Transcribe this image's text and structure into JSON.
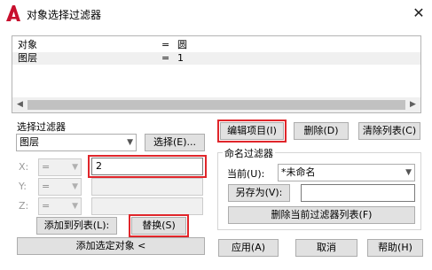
{
  "window": {
    "title": "对象选择过滤器",
    "close_glyph": "✕"
  },
  "list": {
    "rows": [
      {
        "name": "对象",
        "op": "=",
        "value": "圆"
      },
      {
        "name": "图层",
        "op": "=",
        "value": "1"
      }
    ]
  },
  "filter": {
    "group_label": "选择过滤器",
    "type_value": "图层",
    "select_button": "选择(E)...",
    "x_label": "X:",
    "y_label": "Y:",
    "z_label": "Z:",
    "x_op": "=",
    "y_op": "=",
    "z_op": "=",
    "x_value": "2",
    "add_to_list_button": "添加到列表(L):",
    "replace_button": "替换(S)",
    "add_selected_button": "添加选定对象 <"
  },
  "list_buttons": {
    "edit": "编辑项目(I)",
    "delete": "删除(D)",
    "clear": "清除列表(C)"
  },
  "named_filters": {
    "group_label": "命名过滤器",
    "current_label": "当前(U):",
    "current_value": "*未命名",
    "save_as_button": "另存为(V):",
    "save_as_value": "",
    "delete_current_button": "删除当前过滤器列表(F)"
  },
  "footer": {
    "apply": "应用(A)",
    "cancel": "取消",
    "help": "帮助(H)"
  },
  "colors": {
    "highlight": "#e0262b",
    "logo": "#c8102e"
  }
}
